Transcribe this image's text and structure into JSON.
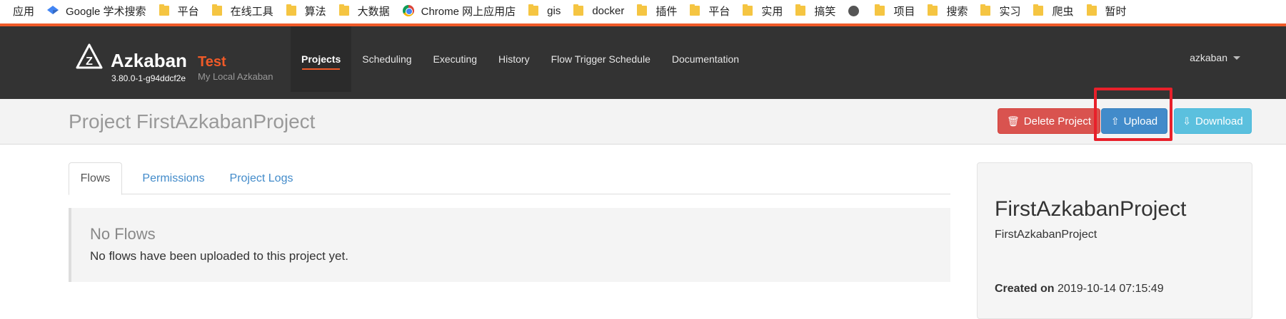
{
  "bookmarks": [
    {
      "label": "应用",
      "icon": "apps-icon"
    },
    {
      "label": "Google 学术搜索",
      "icon": "scholar-icon"
    },
    {
      "label": "平台",
      "icon": "folder-icon"
    },
    {
      "label": "在线工具",
      "icon": "folder-icon"
    },
    {
      "label": "算法",
      "icon": "folder-icon"
    },
    {
      "label": "大数据",
      "icon": "folder-icon"
    },
    {
      "label": "Chrome 网上应用店",
      "icon": "chrome-icon"
    },
    {
      "label": "gis",
      "icon": "folder-icon"
    },
    {
      "label": "docker",
      "icon": "folder-icon"
    },
    {
      "label": "插件",
      "icon": "folder-icon"
    },
    {
      "label": "平台",
      "icon": "folder-icon"
    },
    {
      "label": "实用",
      "icon": "folder-icon"
    },
    {
      "label": "搞笑",
      "icon": "folder-icon"
    },
    {
      "label": "",
      "icon": "globe-icon"
    },
    {
      "label": "项目",
      "icon": "folder-icon"
    },
    {
      "label": "搜索",
      "icon": "folder-icon"
    },
    {
      "label": "实习",
      "icon": "folder-icon"
    },
    {
      "label": "爬虫",
      "icon": "folder-icon"
    },
    {
      "label": "暂时",
      "icon": "folder-icon"
    }
  ],
  "navbar": {
    "brand": "Azkaban",
    "env": "Test",
    "version": "3.80.0-1-g94ddcf2e",
    "subtitle": "My Local Azkaban",
    "items": [
      {
        "label": "Projects",
        "active": true
      },
      {
        "label": "Scheduling",
        "active": false
      },
      {
        "label": "Executing",
        "active": false
      },
      {
        "label": "History",
        "active": false
      },
      {
        "label": "Flow Trigger Schedule",
        "active": false
      },
      {
        "label": "Documentation",
        "active": false
      }
    ],
    "user": "azkaban"
  },
  "header": {
    "title": "Project FirstAzkabanProject",
    "delete_label": "Delete Project",
    "upload_label": "Upload",
    "download_label": "Download"
  },
  "tabs": [
    {
      "label": "Flows",
      "active": true
    },
    {
      "label": "Permissions",
      "active": false
    },
    {
      "label": "Project Logs",
      "active": false
    }
  ],
  "callout": {
    "title": "No Flows",
    "text": "No flows have been uploaded to this project yet."
  },
  "sidebar": {
    "project_name": "FirstAzkabanProject",
    "description": "FirstAzkabanProject",
    "created_label": "Created on",
    "created_value": "2019-10-14 07:15:49"
  },
  "colors": {
    "accent": "#f05a28",
    "navbar": "#333333",
    "delete": "#d9534f",
    "upload": "#428bca",
    "download": "#5bc0de",
    "highlight": "#e8202a"
  }
}
